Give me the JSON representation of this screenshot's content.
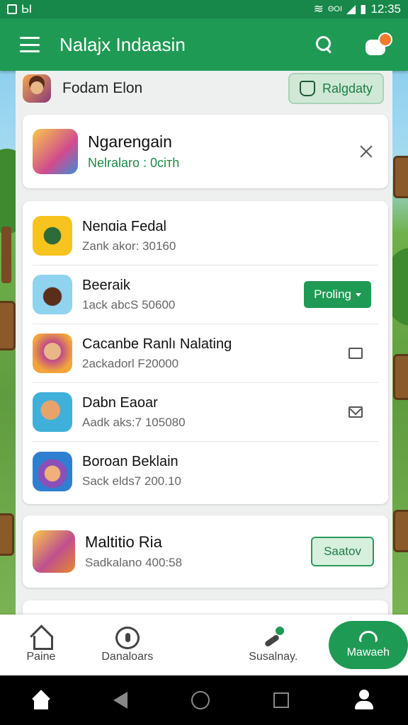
{
  "status_bar": {
    "left_text": "Ы",
    "network": "ΘOI",
    "time": "12:35"
  },
  "app_bar": {
    "title": "Nalajx Indaasin"
  },
  "user": {
    "name": "Fodam Elon",
    "action_label": "Ralgdaty"
  },
  "banner": {
    "title": "Ngarengain",
    "subtitle": "Nelralaro : 0сітh"
  },
  "list": [
    {
      "title": "Nenɑia Fedal",
      "subtitle": "Zank akor: 30160"
    },
    {
      "title": "Beeraik",
      "subtitle": "1ack abcS 50600",
      "button": "Proling"
    },
    {
      "title": "Cacanbe Ranlı Nalating",
      "subtitle": "2ackadorl F20000"
    },
    {
      "title": "Dabn Eaoar",
      "subtitle": "Aadk aks:7 105080"
    },
    {
      "title": "Boroan Beklain",
      "subtitle": "Sack elds7 200.10"
    }
  ],
  "featured": {
    "title": "Maltitio Ria",
    "subtitle": "Sadkalano 400:58",
    "button": "Saatov"
  },
  "bottom_nav": {
    "home": "Paine",
    "downloads": "Danaloars",
    "saved": "Susalnay.",
    "active": "Mawaeh"
  },
  "colors": {
    "primary": "#1f9a55",
    "status_bar": "#17874a"
  }
}
